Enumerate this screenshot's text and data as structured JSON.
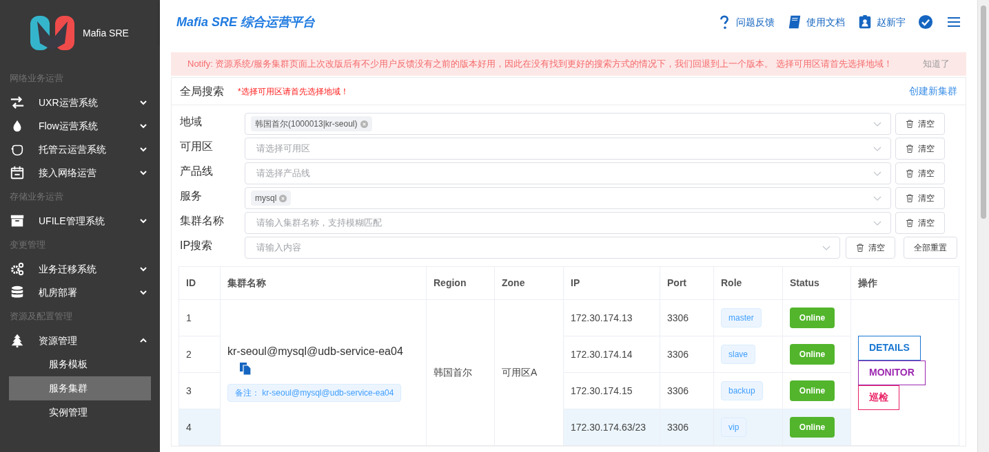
{
  "sidebar": {
    "brand": "Mafia SRE",
    "sections": [
      {
        "title": "网络业务运营",
        "items": [
          {
            "label": "UXR运营系统",
            "expanded": false
          },
          {
            "label": "Flow运营系统",
            "expanded": false
          },
          {
            "label": "托管云运营系统",
            "expanded": false
          },
          {
            "label": "接入网络运营",
            "expanded": false
          }
        ]
      },
      {
        "title": "存储业务运营",
        "items": [
          {
            "label": "UFILE管理系统",
            "expanded": false
          }
        ]
      },
      {
        "title": "变更管理",
        "items": [
          {
            "label": "业务迁移系统",
            "expanded": false
          },
          {
            "label": "机房部署",
            "expanded": false
          }
        ]
      },
      {
        "title": "资源及配置管理",
        "items": [
          {
            "label": "资源管理",
            "expanded": true,
            "children": [
              {
                "label": "服务模板",
                "selected": false
              },
              {
                "label": "服务集群",
                "selected": true
              },
              {
                "label": "实例管理",
                "selected": false
              }
            ]
          }
        ]
      }
    ]
  },
  "header": {
    "title": "Mafia SRE 综合运营平台",
    "actions": [
      "问题反馈",
      "使用文档",
      "赵新宇"
    ]
  },
  "notice": {
    "text": "Notify: 资源系统/服务集群页面上次改版后有不少用户反馈没有之前的版本好用，因此在没有找到更好的搜索方式的情况下，我们回退到上一个版本。 选择可用区请首先选择地域！",
    "dismiss": "知道了"
  },
  "search_panel": {
    "title": "全局搜索",
    "hint": "*选择可用区请首先选择地域！",
    "create_link": "创建新集群",
    "fields": [
      {
        "label": "地域",
        "tags": [
          "韩国首尔(1000013|kr-seoul)"
        ],
        "clear": "清空"
      },
      {
        "label": "可用区",
        "placeholder": "请选择可用区",
        "clear": "清空"
      },
      {
        "label": "产品线",
        "placeholder": "请选择产品线",
        "clear": "清空"
      },
      {
        "label": "服务",
        "tags": [
          "mysql"
        ],
        "clear": "清空"
      },
      {
        "label": "集群名称",
        "placeholder": "请输入集群名称，支持模糊匹配",
        "clear": "清空"
      },
      {
        "label": "IP搜索",
        "placeholder": "请输入内容",
        "clear": "清空",
        "reset": "全部重置"
      }
    ]
  },
  "table": {
    "columns": [
      "ID",
      "集群名称",
      "Region",
      "Zone",
      "IP",
      "Port",
      "Role",
      "Status",
      "操作"
    ],
    "cluster": {
      "name": "kr-seoul@mysql@udb-service-ea04",
      "note": "备注： kr-seoul@mysql@udb-service-ea04",
      "region": "韩国首尔",
      "zone": "可用区A",
      "actions": [
        {
          "label": "DETAILS",
          "color": "#1976d2"
        },
        {
          "label": "MONITOR",
          "color": "#9c27b0"
        },
        {
          "label": "巡检",
          "color": "#e91e63"
        }
      ]
    },
    "rows": [
      {
        "id": "1",
        "ip": "172.30.174.13",
        "port": "3306",
        "role": "master",
        "status": "Online",
        "selected": false
      },
      {
        "id": "2",
        "ip": "172.30.174.14",
        "port": "3306",
        "role": "slave",
        "status": "Online",
        "selected": false
      },
      {
        "id": "3",
        "ip": "172.30.174.15",
        "port": "3306",
        "role": "backup",
        "status": "Online",
        "selected": false
      },
      {
        "id": "4",
        "ip": "172.30.174.63/23",
        "port": "3306",
        "role": "vip",
        "status": "Online",
        "selected": true
      }
    ]
  }
}
